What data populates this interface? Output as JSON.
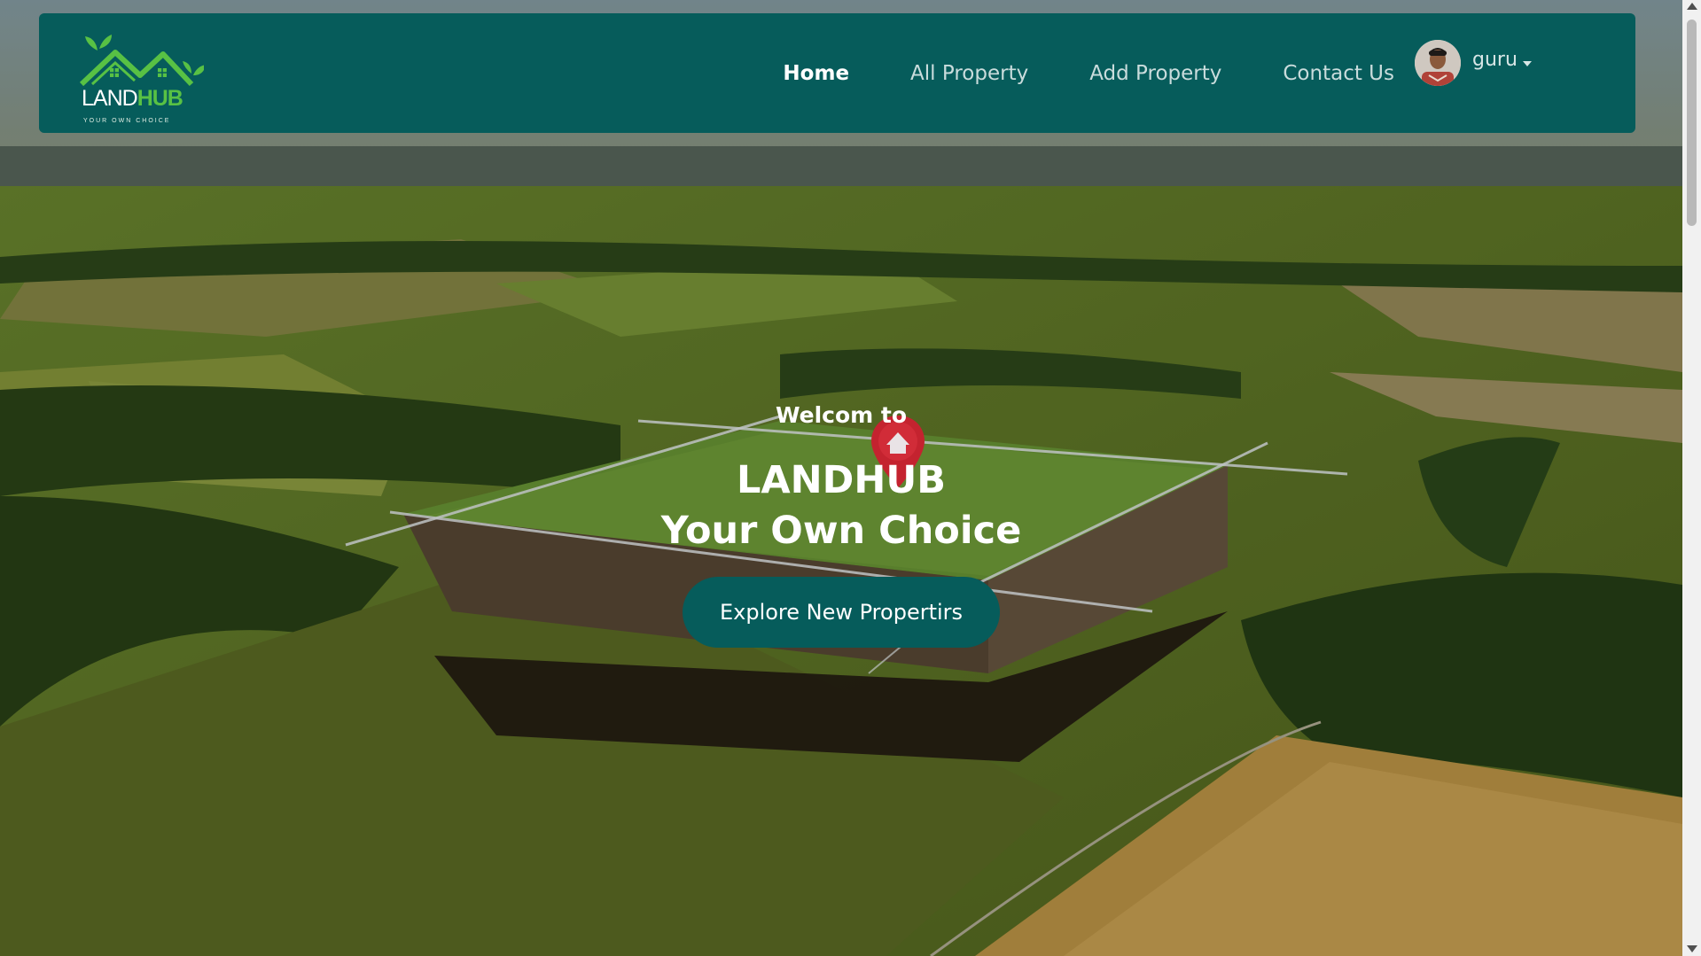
{
  "brand": {
    "name_part1": "LAND",
    "name_part2": "HUB",
    "tagline": "YOUR OWN CHOICE",
    "logo_icon": "house-leaves-logo"
  },
  "nav": {
    "items": [
      {
        "label": "Home",
        "active": true
      },
      {
        "label": "All Property",
        "active": false
      },
      {
        "label": "Add Property",
        "active": false
      },
      {
        "label": "Contact Us",
        "active": false
      }
    ],
    "user": {
      "name": "guru",
      "avatar_icon": "user-avatar",
      "menu_icon": "caret-down-icon"
    }
  },
  "hero": {
    "welcome": "Welcom to",
    "title_line1": "LANDHUB",
    "title_line2": "Your Own Choice",
    "cta_label": "Explore New Propertirs",
    "pin_icon": "location-pin-icon"
  },
  "colors": {
    "nav_bg": "#065c5b",
    "cta_bg": "#065c5b",
    "logo_green": "#58c144",
    "pin_red": "#c4232f"
  }
}
